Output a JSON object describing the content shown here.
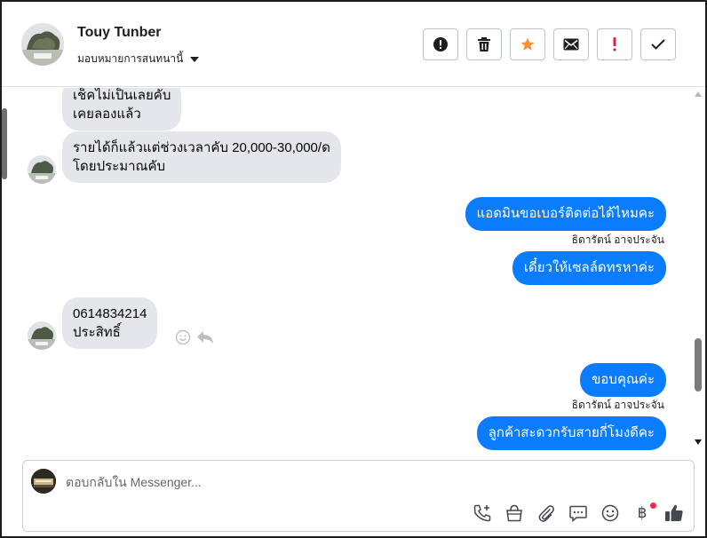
{
  "header": {
    "contact_name": "Touy Tunber",
    "assign_label": "มอบหมายการสนทนานี้",
    "actions": [
      {
        "name": "report-spam-button",
        "icon": "alert-octagon-icon"
      },
      {
        "name": "delete-button",
        "icon": "trash-icon"
      },
      {
        "name": "star-button",
        "icon": "star-icon",
        "color": "#f7923b"
      },
      {
        "name": "mark-unread-button",
        "icon": "envelope-icon"
      },
      {
        "name": "follow-up-button",
        "icon": "exclamation-icon",
        "color": "#e41e3f"
      },
      {
        "name": "mark-done-button",
        "icon": "check-icon"
      }
    ]
  },
  "messages": [
    {
      "direction": "in",
      "lines": [
        "เช็คไม่เป็นเลยคับ",
        "เคยลองแล้ว"
      ]
    },
    {
      "direction": "in",
      "lines": [
        "รายได้ก็แล้วแต่ช่วงเวลาคับ 20,000-30,000/ด",
        "โดยประมาณคับ"
      ]
    },
    {
      "direction": "out",
      "text": "แอดมินขอเบอร์ติดต่อได้ไหมคะ",
      "sender": "ธิดารัตน์ อาจประจัน"
    },
    {
      "direction": "out",
      "text": "เดี๋ยวให้เซลล์ดทรหาค่ะ"
    },
    {
      "direction": "in",
      "lines": [
        "0614834214",
        "ประสิทธิ์"
      ]
    },
    {
      "direction": "out",
      "text": "ขอบคุณค่ะ",
      "sender": "ธิดารัตน์ อาจประจัน"
    },
    {
      "direction": "out",
      "text": "ลูกค้าสะดวกรับสายกี่โมงดีคะ"
    }
  ],
  "composer": {
    "placeholder": "ตอบกลับใน Messenger...",
    "value": "",
    "tools": [
      "phone-plus-icon",
      "shopping-bag-icon",
      "paperclip-icon",
      "saved-reply-icon",
      "emoji-icon",
      "baht-payment-icon",
      "like-icon"
    ],
    "baht_symbol": "฿"
  },
  "colors": {
    "outgoing_bubble": "#0a7cff",
    "incoming_bubble": "#e4e6eb",
    "notification_dot": "#f0284a"
  }
}
